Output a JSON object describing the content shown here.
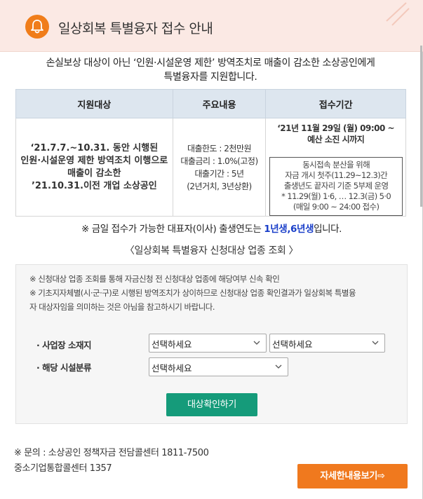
{
  "header": {
    "title": "일상회복 특별융자 접수 안내",
    "accent": "#f07d1a"
  },
  "intro": {
    "line1": "손실보상 대상이 아닌 ‘인원·시설운영 제한’ 방역조치로 매출이 감소한 소상공인에게",
    "line2": "특별융자를 지원합니다."
  },
  "table": {
    "headers": [
      "지원대상",
      "주요내용",
      "접수기간"
    ],
    "target": [
      "‘21.7.7.~10.31. 동안 시행된",
      "인원·시설운영 제한 방역조치 이행으로",
      "매출이 감소한",
      "’21.10.31.이전 개업 소상공인"
    ],
    "content": [
      "대출한도 : 2천만원",
      "대출금리 : 1.0%(고정)",
      "대출기간 : 5년",
      "(2년거치, 3년상환)"
    ],
    "period": [
      "‘21년 11월 29일 (월) 09:00 ~",
      "예산 소진 시까지"
    ],
    "note": [
      "동시접속 분산을 위해",
      "자금 개시 첫주(11.29~12.3)간",
      "출생년도 끝자리 기준 5부제 운영",
      "* 11.29(월) 1·6, … 12.3(금) 5·0",
      "(매일 9:00 ~ 24:00 접수)"
    ]
  },
  "notice": {
    "prefix": "※ 금일 접수가 가능한 대표자(이사) 출생연도는 ",
    "highlight": "1년생,6년생",
    "suffix": "입니다.",
    "highlight_color": "#1a3fc9"
  },
  "subtitle": "〈일상회복 특별융자 신청대상 업종 조회 〉",
  "search": {
    "desc1": "※ 신청대상 업종 조회를 통해 자금신청 전 신청대상 업종에 해당여부 신속 확인",
    "desc2": "※ 기초지자체별(시·군·구)로 시행된 방역조치가 상이하므로 신청대상 업종 확인결과가 일상회복 특별융",
    "desc3": "자 대상자임을 의미하는 것은 아님을 참고하시기 바랍니다.",
    "location_label": "· 사업장 소재지",
    "facility_label": "· 해당 시설분류",
    "select1": "선택하세요",
    "select2": "선택하세요",
    "select3": "선택하세요",
    "button": "대상확인하기",
    "button_color": "#159b7a"
  },
  "contact": {
    "line1": "※ 문의 : 소상공인 정책자금 전담콜센터 1811-7500",
    "line2": "중소기업통합콜센터 1357"
  },
  "detail_button": {
    "label": "자세한내용보기⇨",
    "color": "#f0791e"
  }
}
